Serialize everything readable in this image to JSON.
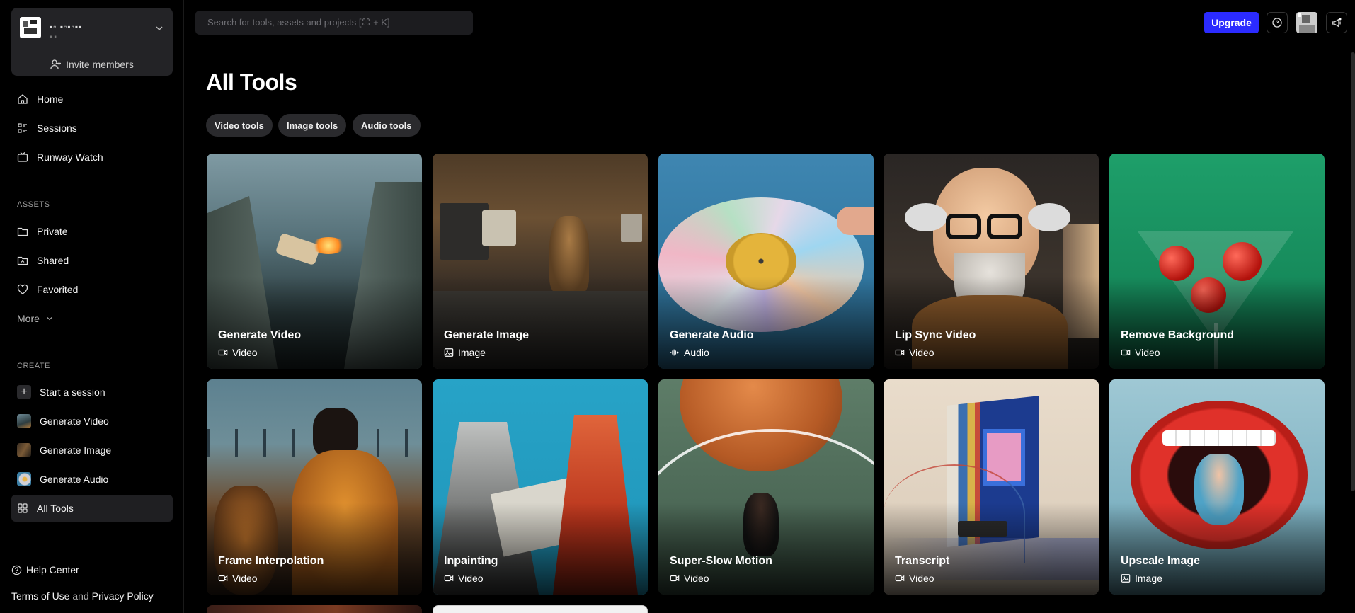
{
  "workspace": {
    "name": "▪▫ ▪▫▪▫▪▪",
    "sub": "▪ ▪"
  },
  "invite_label": "Invite members",
  "nav": [
    {
      "label": "Home",
      "icon": "home-icon"
    },
    {
      "label": "Sessions",
      "icon": "sessions-icon"
    },
    {
      "label": "Runway Watch",
      "icon": "tv-icon"
    }
  ],
  "assets": {
    "heading": "ASSETS",
    "items": [
      {
        "label": "Private",
        "icon": "folder-icon"
      },
      {
        "label": "Shared",
        "icon": "shared-folder-icon"
      },
      {
        "label": "Favorited",
        "icon": "heart-icon"
      }
    ],
    "more_label": "More"
  },
  "create": {
    "heading": "CREATE",
    "items": [
      {
        "label": "Start a session",
        "icon": "plus-icon"
      },
      {
        "label": "Generate Video",
        "icon": "video-thumb"
      },
      {
        "label": "Generate Image",
        "icon": "image-thumb"
      },
      {
        "label": "Generate Audio",
        "icon": "audio-thumb"
      },
      {
        "label": "All Tools",
        "icon": "grid-icon"
      }
    ]
  },
  "footer": {
    "help": "Help Center",
    "terms": "Terms of Use",
    "and": "and",
    "privacy": "Privacy Policy"
  },
  "search": {
    "placeholder": "Search for tools, assets and projects [⌘ + K]"
  },
  "header": {
    "upgrade": "Upgrade"
  },
  "page": {
    "title": "All Tools"
  },
  "filters": [
    "Video tools",
    "Image tools",
    "Audio tools"
  ],
  "tools": [
    {
      "title": "Generate Video",
      "type": "Video"
    },
    {
      "title": "Generate Image",
      "type": "Image"
    },
    {
      "title": "Generate Audio",
      "type": "Audio"
    },
    {
      "title": "Lip Sync Video",
      "type": "Video"
    },
    {
      "title": "Remove Background",
      "type": "Video"
    },
    {
      "title": "Frame Interpolation",
      "type": "Video"
    },
    {
      "title": "Inpainting",
      "type": "Video"
    },
    {
      "title": "Super-Slow Motion",
      "type": "Video"
    },
    {
      "title": "Transcript",
      "type": "Video"
    },
    {
      "title": "Upscale Image",
      "type": "Image"
    }
  ],
  "colors": {
    "accent": "#2b2bff",
    "background": "#000000",
    "surface": "#232326"
  }
}
